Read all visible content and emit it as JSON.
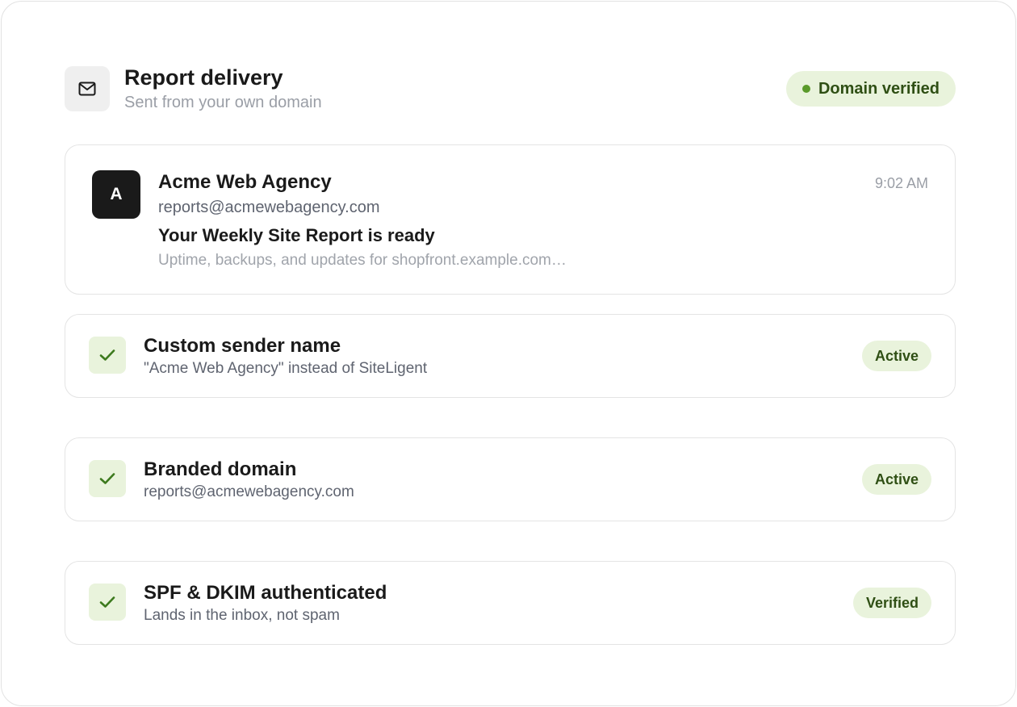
{
  "header": {
    "icon": "mail-icon",
    "title": "Report delivery",
    "subtitle": "Sent from your own domain",
    "badge": "Domain verified",
    "badge_color": "#5a9a2a"
  },
  "email_preview": {
    "avatar_letter": "A",
    "sender_name": "Acme Web Agency",
    "sender_email": "reports@acmewebagency.com",
    "subject": "Your Weekly Site Report is ready",
    "preview": "Uptime, backups, and updates for shopfront.example.com…",
    "time": "9:02 AM"
  },
  "features": [
    {
      "icon": "check-icon",
      "title": "Custom sender name",
      "description": "\"Acme Web Agency\" instead of SiteLigent",
      "status": "Active"
    },
    {
      "icon": "check-icon",
      "title": "Branded domain",
      "description": "reports@acmewebagency.com",
      "status": "Active"
    },
    {
      "icon": "check-icon",
      "title": "SPF & DKIM authenticated",
      "description": "Lands in the inbox, not spam",
      "status": "Verified"
    }
  ],
  "colors": {
    "accent_bg": "#e9f3dc",
    "accent_text": "#2f4f14",
    "check": "#3d7a1e"
  }
}
